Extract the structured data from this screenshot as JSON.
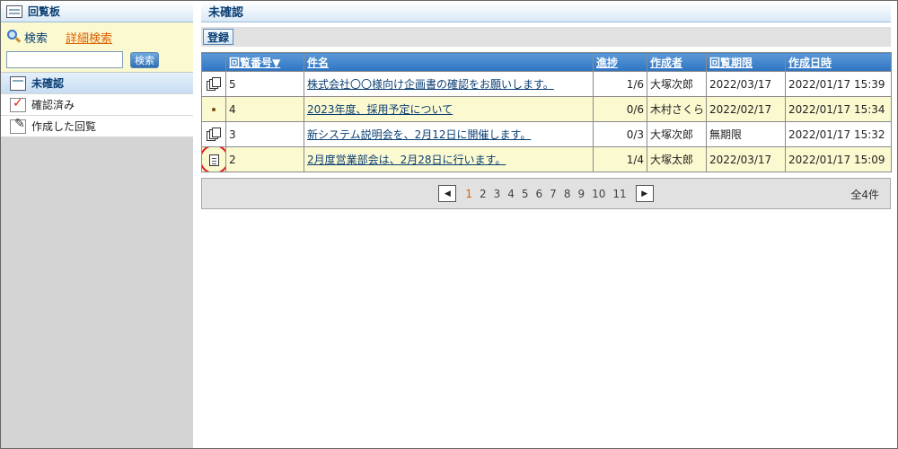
{
  "sidebar": {
    "title": "回覧板",
    "search_label": "検索",
    "advanced_search_label": "詳細検索",
    "search_input_value": "",
    "search_button_label": "検索",
    "items": [
      {
        "label": "未確認",
        "icon": "board-icon",
        "active": true
      },
      {
        "label": "確認済み",
        "icon": "check-icon",
        "active": false
      },
      {
        "label": "作成した回覧",
        "icon": "pen-icon",
        "active": false
      }
    ]
  },
  "main": {
    "title": "未確認",
    "register_button_label": "登録",
    "columns": {
      "number": "回覧番号▼",
      "subject": "件名",
      "progress": "進捗",
      "creator": "作成者",
      "deadline": "回覧期限",
      "created": "作成日時"
    },
    "rows": [
      {
        "icon": "multi-doc-icon",
        "number": "5",
        "subject": "株式会社〇〇様向け企画書の確認をお願いします。",
        "progress": "1/6",
        "creator": "大塚次郎",
        "deadline": "2022/03/17",
        "created": "2022/01/17 15:39"
      },
      {
        "icon": "dot-icon",
        "number": "4",
        "subject": "2023年度、採用予定について",
        "progress": "0/6",
        "creator": "木村さくら",
        "deadline": "2022/02/17",
        "created": "2022/01/17 15:34"
      },
      {
        "icon": "multi-doc-icon",
        "number": "3",
        "subject": "新システム説明会を、2月12日に開催します。",
        "progress": "0/3",
        "creator": "大塚次郎",
        "deadline": "無期限",
        "created": "2022/01/17 15:32"
      },
      {
        "icon": "single-doc-icon",
        "number": "2",
        "subject": "2月度営業部会は、2月28日に行います。",
        "progress": "1/4",
        "creator": "大塚太郎",
        "deadline": "2022/03/17",
        "created": "2022/01/17 15:09"
      }
    ],
    "pager": {
      "pages": [
        "1",
        "2",
        "3",
        "4",
        "5",
        "6",
        "7",
        "8",
        "9",
        "10",
        "11"
      ],
      "current": "1",
      "total": "全4件"
    }
  },
  "colors": {
    "header_blue": "#2f74c2",
    "highlight_row": "#fbf9d0",
    "link": "#0b3f73",
    "accent_orange": "#e06000",
    "annotation_red": "#e01818"
  }
}
